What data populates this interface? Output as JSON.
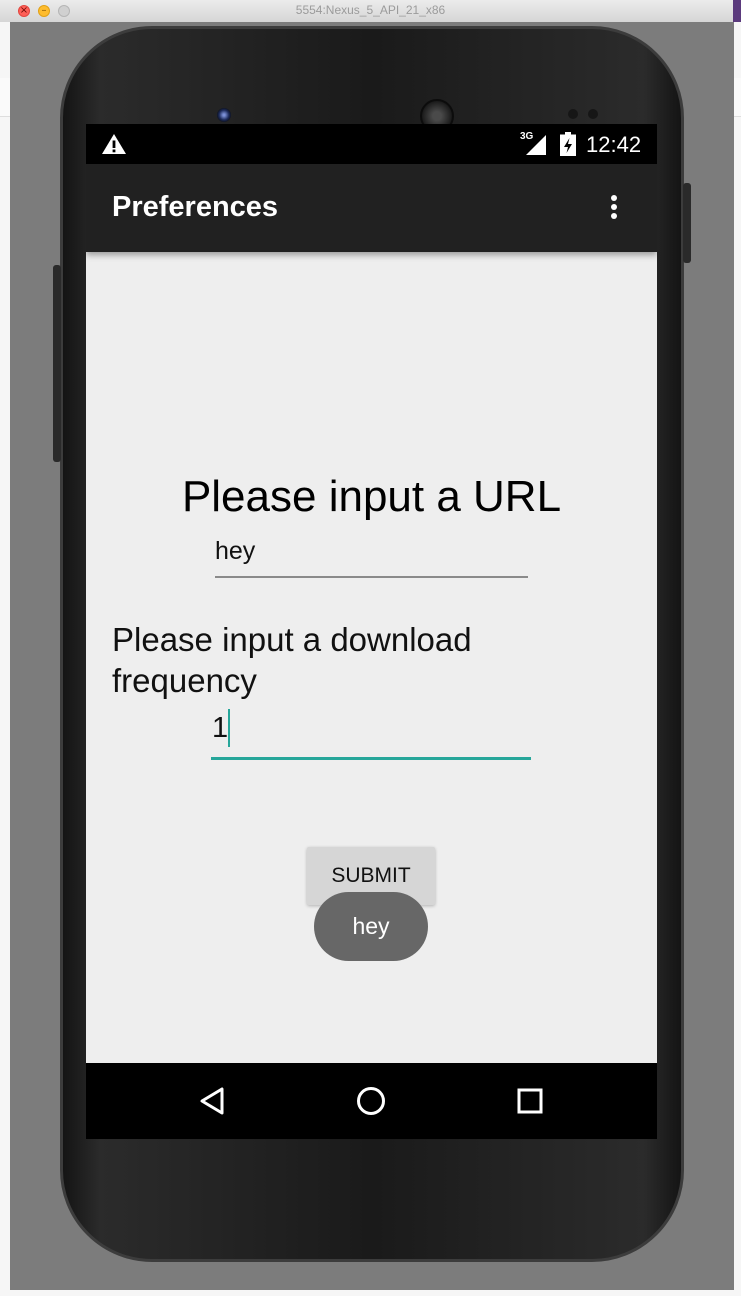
{
  "window": {
    "title": "5554:Nexus_5_API_21_x86",
    "close_glyph": "×",
    "minimize_glyph": "–"
  },
  "status_bar": {
    "network_type": "3G",
    "time": "12:42",
    "icons": [
      "warning-icon",
      "cellular-signal-icon",
      "battery-charging-icon"
    ]
  },
  "app_bar": {
    "title": "Preferences",
    "overflow_icon": "more-vert-icon"
  },
  "form": {
    "url_label": "Please input a URL",
    "url_value": "hey",
    "frequency_label": "Please input a download frequency",
    "frequency_value": "1",
    "submit_label": "SUBMIT"
  },
  "toast": {
    "message": "hey"
  },
  "nav_bar": {
    "icons": [
      "back-icon",
      "home-icon",
      "recents-icon"
    ]
  },
  "colors": {
    "accent": "#26a69a",
    "app_bar": "#212121",
    "screen_background": "#eeeeee",
    "toast": "#676767"
  }
}
